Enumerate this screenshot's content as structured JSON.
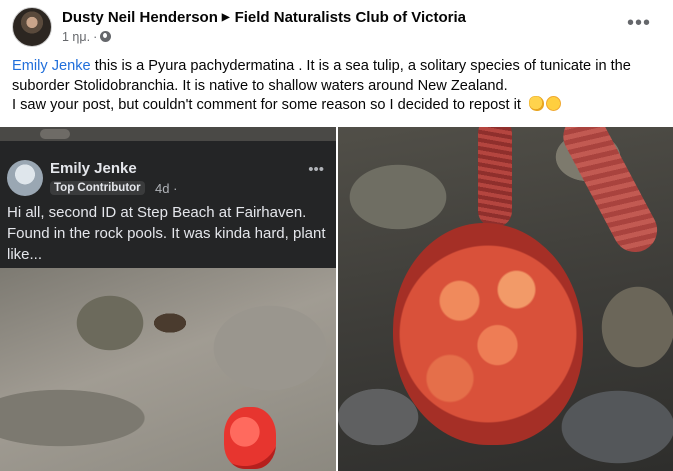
{
  "post": {
    "author": "Dusty Neil Henderson",
    "group": "Field Naturalists Club of Victoria",
    "time": "1 ημ.",
    "separator": "·",
    "more": "•••",
    "text": {
      "mention": "Emily Jenke",
      "line1_rest": " this is a Pyura pachydermatina . It is a sea tulip, a solitary species of tunicate in the",
      "line2": "suborder Stolidobranchia. It is native to shallow waters around New Zealand.",
      "line3": "I saw your post, but couldn't comment for some reason so I decided to repost it"
    }
  },
  "embedded": {
    "name": "Emily Jenke",
    "badge": "Top Contributor",
    "time": "4d ·",
    "more": "•••",
    "text": "Hi all, second ID at Step Beach at Fairhaven. Found in the rock pools. It was kinda hard, plant like..."
  },
  "colors": {
    "link": "#216fdb",
    "secondary_text": "#65676b",
    "embedded_bg": "#242526"
  },
  "icons": [
    "avatar",
    "globe-icon",
    "more-icon",
    "punch-emoji",
    "grin-emoji"
  ]
}
